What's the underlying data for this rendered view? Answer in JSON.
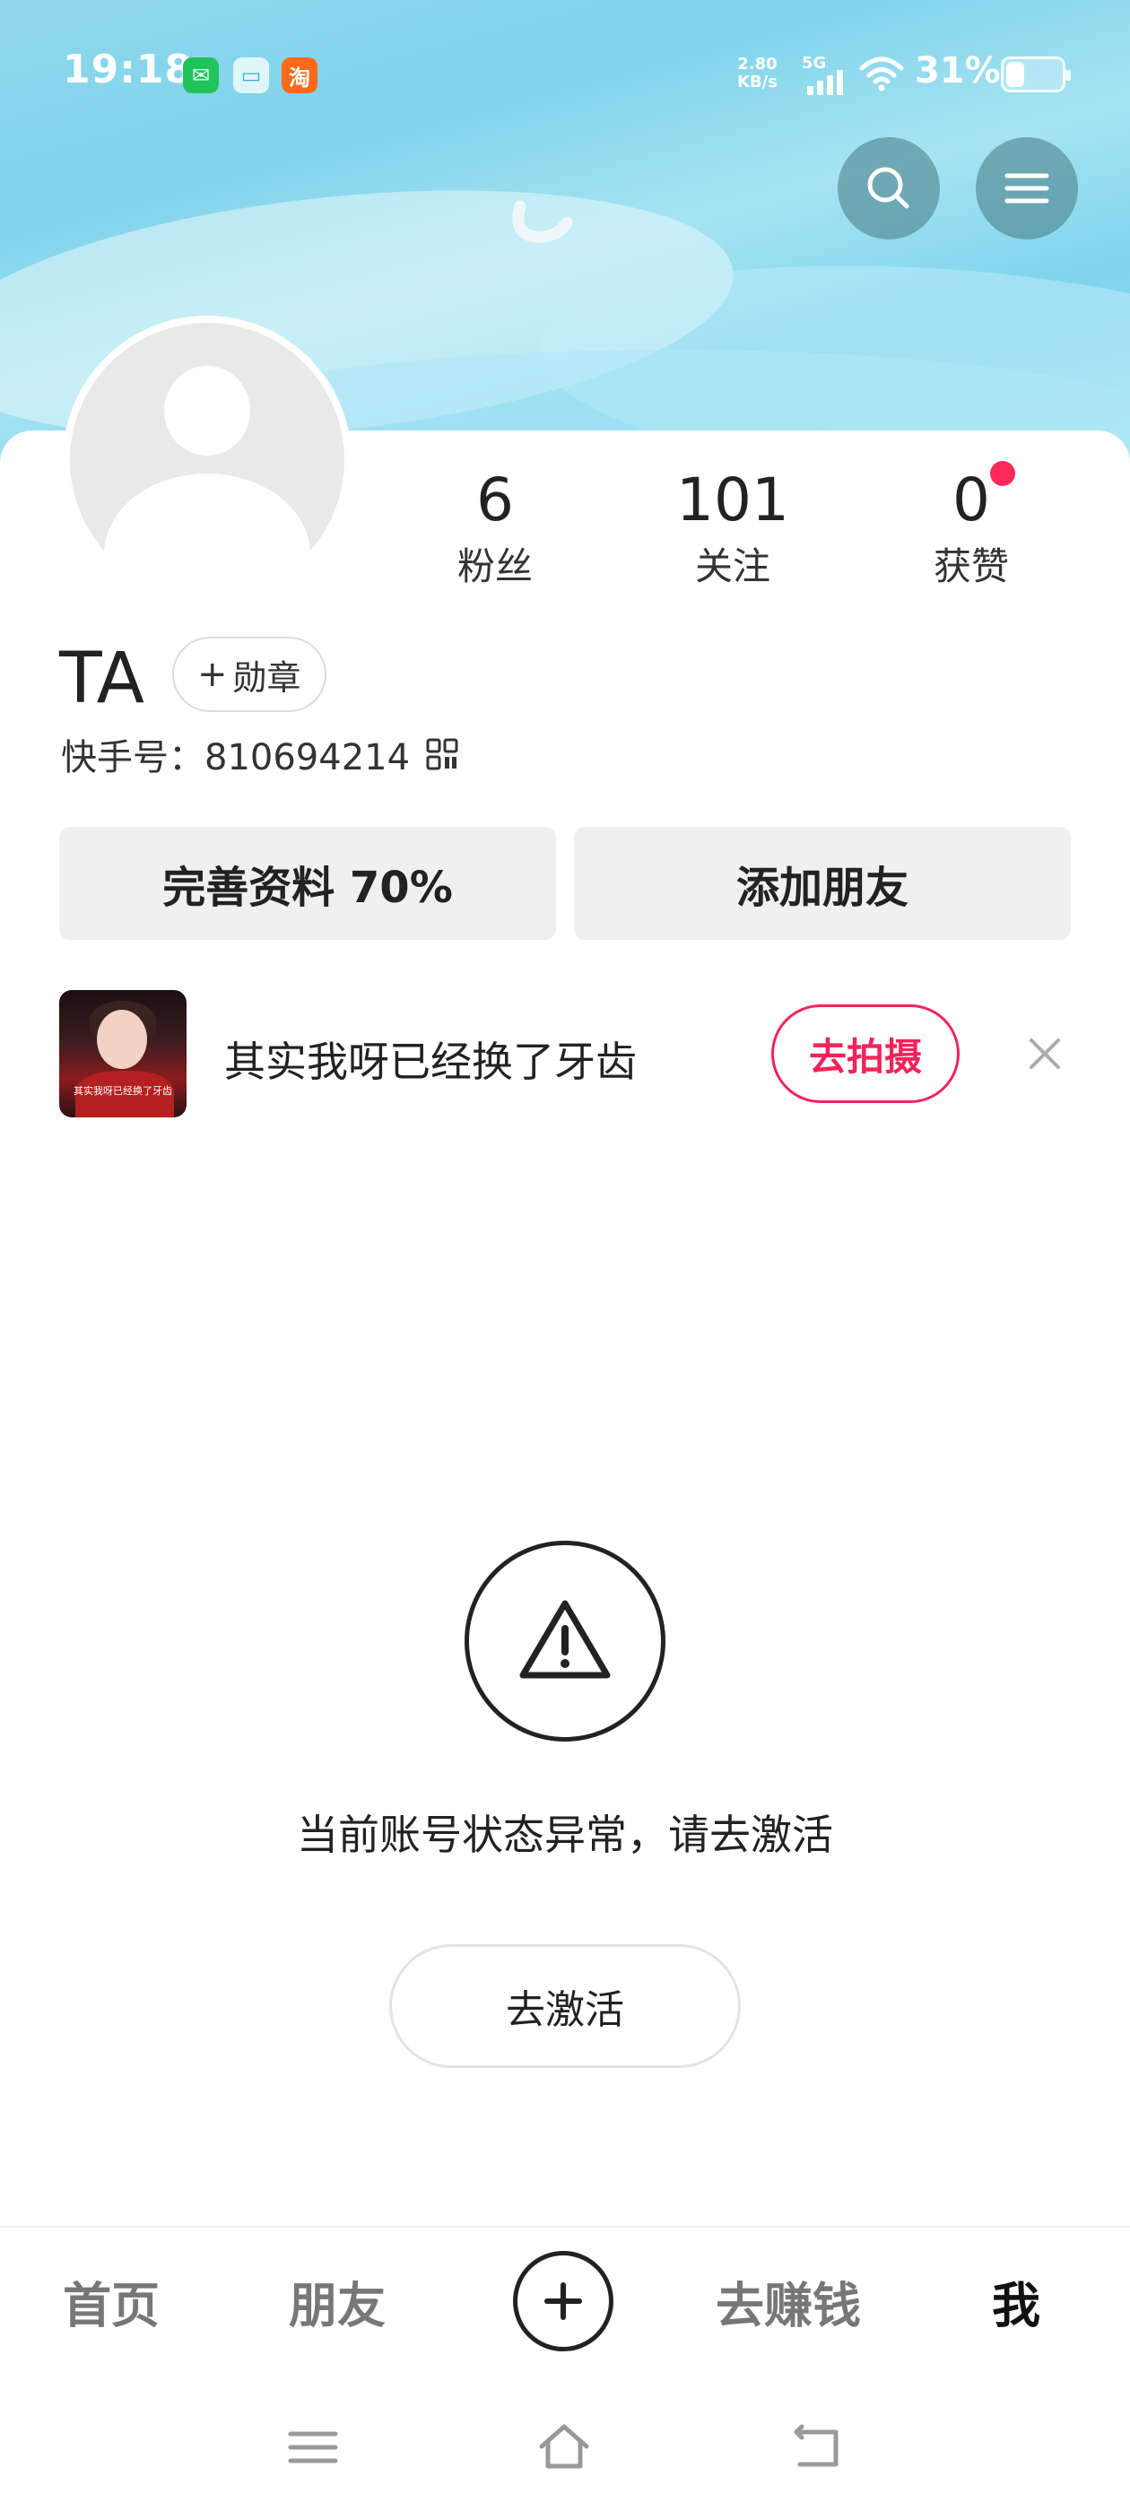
{
  "status_bar": {
    "time": "19:18",
    "app_icons": [
      {
        "name": "wechat-notification-icon",
        "glyph": "✉"
      },
      {
        "name": "message-notification-icon",
        "glyph": "▭"
      },
      {
        "name": "taobao-notification-icon",
        "glyph": "淘"
      }
    ],
    "net_speed_value": "2.80",
    "net_speed_unit": "KB/s",
    "network_type": "5G",
    "battery_percent": "31%",
    "battery_level": 0.31
  },
  "header": {
    "search_icon": "search-icon",
    "menu_icon": "menu-icon"
  },
  "profile": {
    "stats": [
      {
        "value": "6",
        "label": "粉丝"
      },
      {
        "value": "101",
        "label": "关注"
      },
      {
        "value": "0",
        "label": "获赞"
      }
    ],
    "name": "TA",
    "badge_button": {
      "plus": "+",
      "label": "勋章"
    },
    "kwai_id": "快手号：810694214",
    "actions": {
      "complete_profile": "完善资料 70%",
      "add_friend": "添加朋友"
    }
  },
  "suggestion": {
    "text": "其实我呀已经换了牙齿",
    "thumb_caption": "其实我呀已经换了牙齿",
    "shoot_button": "去拍摄"
  },
  "notice": {
    "message": "当前账号状态异常，请去激活",
    "activate_button": "去激活"
  },
  "tabbar": {
    "tabs": [
      "首页",
      "朋友",
      "去赚钱",
      "我"
    ],
    "active_tab": "我"
  },
  "colors": {
    "accent": "#f0245a",
    "notification_dot": "#ff2a57",
    "cover_blue": "#7fd3ea"
  }
}
